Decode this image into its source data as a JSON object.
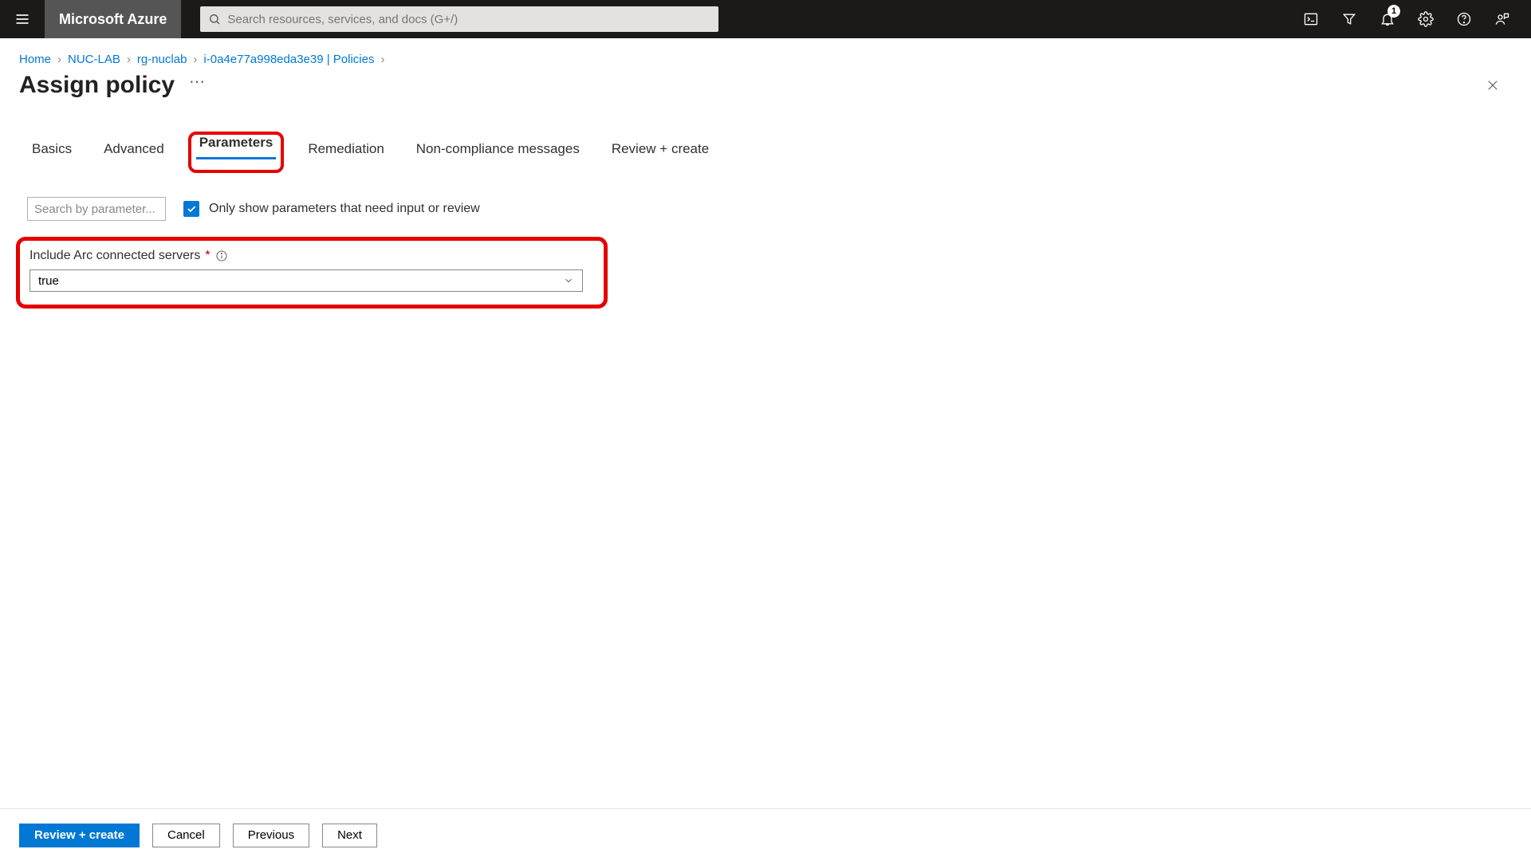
{
  "header": {
    "brand": "Microsoft Azure",
    "search_placeholder": "Search resources, services, and docs (G+/)",
    "notification_count": "1"
  },
  "breadcrumb": {
    "items": [
      "Home",
      "NUC-LAB",
      "rg-nuclab",
      "i-0a4e77a998eda3e39 | Policies"
    ]
  },
  "page": {
    "title": "Assign policy",
    "more": "⋯"
  },
  "tabs": {
    "items": [
      {
        "label": "Basics",
        "active": false,
        "highlighted": false
      },
      {
        "label": "Advanced",
        "active": false,
        "highlighted": false
      },
      {
        "label": "Parameters",
        "active": true,
        "highlighted": true
      },
      {
        "label": "Remediation",
        "active": false,
        "highlighted": false
      },
      {
        "label": "Non-compliance messages",
        "active": false,
        "highlighted": false
      },
      {
        "label": "Review + create",
        "active": false,
        "highlighted": false
      }
    ]
  },
  "filters": {
    "search_placeholder": "Search by parameter...",
    "only_needed_label": "Only show parameters that need input or review",
    "only_needed_checked": true
  },
  "parameter": {
    "label": "Include Arc connected servers",
    "required": true,
    "value": "true"
  },
  "footer": {
    "review_create": "Review + create",
    "cancel": "Cancel",
    "previous": "Previous",
    "next": "Next"
  }
}
